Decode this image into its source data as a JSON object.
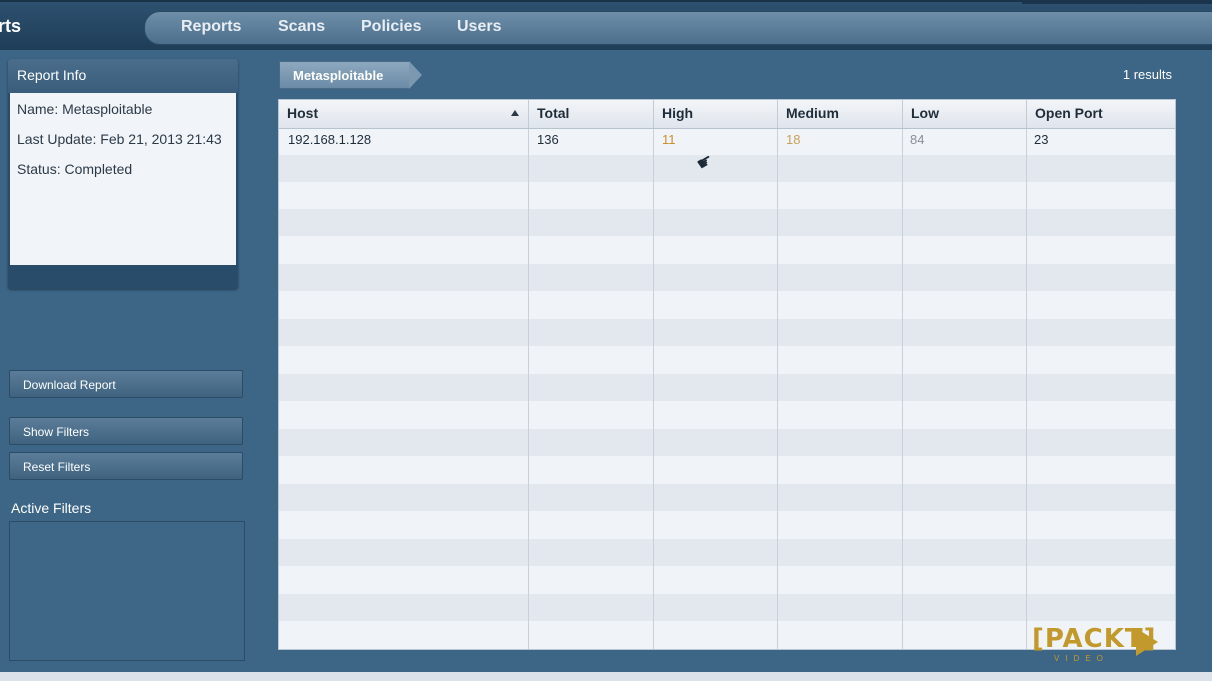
{
  "app": {
    "title": "rts"
  },
  "nav": {
    "items": [
      "Reports",
      "Scans",
      "Policies",
      "Users"
    ]
  },
  "report_info": {
    "header": "Report Info",
    "name_line": "Name: Metasploitable",
    "update_line": "Last Update: Feb 21, 2013 21:43",
    "status_line": "Status: Completed"
  },
  "buttons": {
    "download": "Download Report",
    "show_filters": "Show Filters",
    "reset_filters": "Reset Filters"
  },
  "filters": {
    "label": "Active Filters"
  },
  "breadcrumb": {
    "label": "Metasploitable"
  },
  "results": {
    "text": "1  results"
  },
  "table": {
    "columns": [
      "Host",
      "Total",
      "High",
      "Medium",
      "Low",
      "Open Port"
    ],
    "sort_column": "Host",
    "sort_direction": "ascending",
    "rows": [
      {
        "host": "192.168.1.128",
        "total": "136",
        "high": "11",
        "medium": "18",
        "low": "84",
        "open_port": "23"
      }
    ]
  },
  "colors": {
    "high": "#c9902a",
    "medium": "#c9a25a",
    "low": "#8a9097",
    "accent": "#3c6586"
  },
  "logo": {
    "text": "[PACKT]",
    "sub": "VIDEO"
  }
}
